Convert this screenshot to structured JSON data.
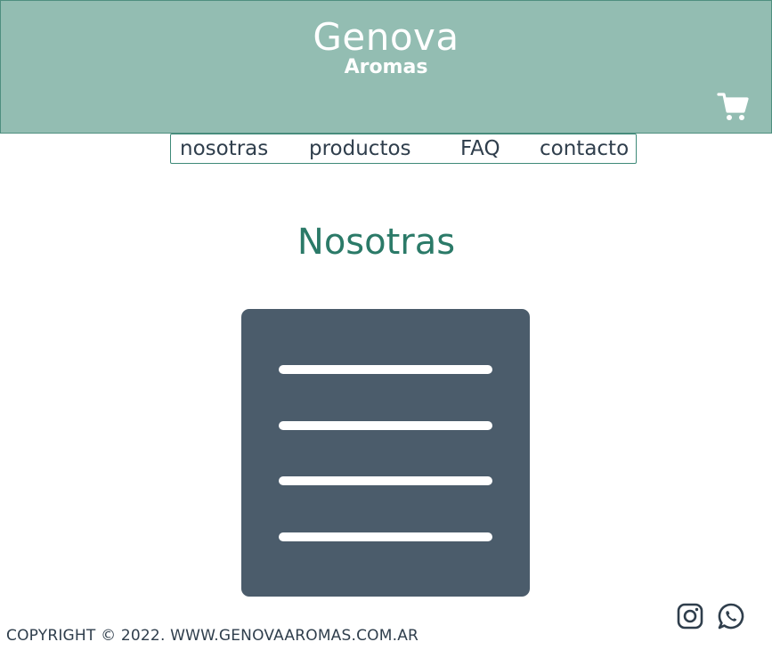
{
  "header": {
    "brand_title": "Genova",
    "brand_subtitle": "Aromas",
    "cart_icon": "cart-icon"
  },
  "nav": {
    "items": [
      {
        "label": "nosotras"
      },
      {
        "label": "productos"
      },
      {
        "label": "FAQ"
      },
      {
        "label": "contacto"
      }
    ]
  },
  "main": {
    "title": "Nosotras",
    "image_icon": "document-lines-icon"
  },
  "footer": {
    "copyright": "COPYRIGHT © 2022. WWW.GENOVAAROMAS.COM.AR",
    "social": [
      {
        "icon": "instagram-icon"
      },
      {
        "icon": "whatsapp-icon"
      }
    ]
  },
  "colors": {
    "header_bg": "#93bdb2",
    "accent": "#2b7a68",
    "text_dark": "#2f3e4c",
    "card_bg": "#4b5c6b"
  }
}
